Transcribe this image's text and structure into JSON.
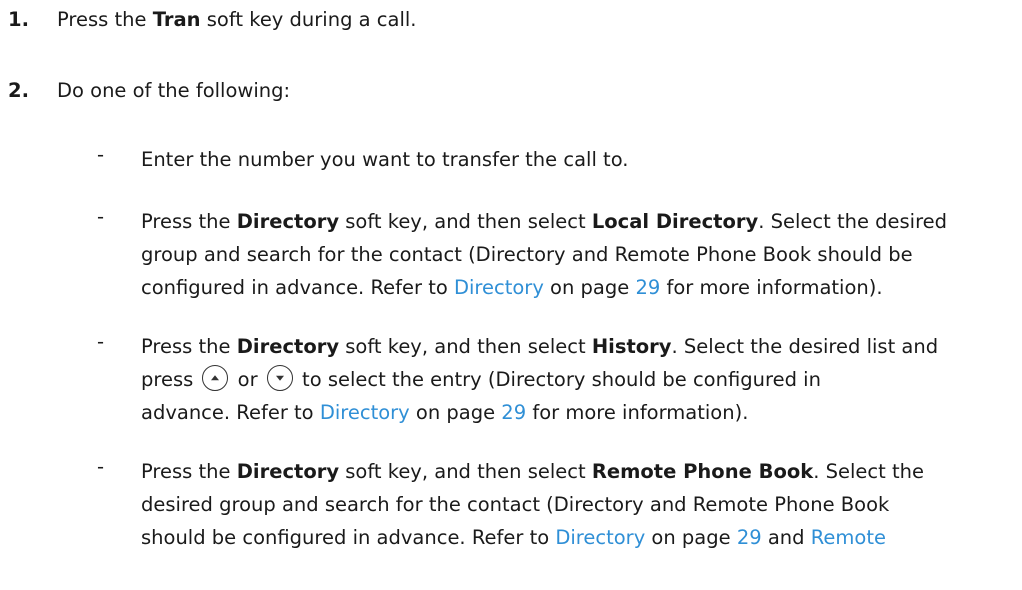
{
  "step1": {
    "number": "1.",
    "pre": "Press the ",
    "key": "Tran",
    "post": " soft key during a call."
  },
  "step2": {
    "number": "2.",
    "text": "Do one of the following:"
  },
  "options": [
    {
      "dash": "-",
      "text": "Enter the number you want to transfer the call to."
    },
    {
      "dash": "-",
      "l1_pre": "Press the ",
      "l1_b1": "Directory",
      "l1_mid": " soft key, and then select ",
      "l1_b2": "Local Directory",
      "l1_post": ". Select the desired",
      "l2": "group and search for the contact (Directory and Remote Phone Book should be",
      "l3_pre": "configured in advance. Refer to ",
      "l3_link": "Directory",
      "l3_mid": " on page ",
      "l3_page": "29",
      "l3_post": " for more information)."
    },
    {
      "dash": "-",
      "l1_pre": "Press the ",
      "l1_b1": "Directory",
      "l1_mid": " soft key, and then select ",
      "l1_b2": "History",
      "l1_post": ". Select the desired list and",
      "l2_pre": "press ",
      "l2_up_icon": "up-arrow-key-icon",
      "l2_or": " or ",
      "l2_down_icon": "down-arrow-key-icon",
      "l2_post": " to select the entry (Directory should be configured in",
      "l3_pre": "advance. Refer to ",
      "l3_link": "Directory",
      "l3_mid": " on page ",
      "l3_page": "29",
      "l3_post": " for more information)."
    },
    {
      "dash": "-",
      "l1_pre": "Press the ",
      "l1_b1": "Directory",
      "l1_mid": " soft key, and then select ",
      "l1_b2": "Remote Phone Book",
      "l1_post": ". Select the",
      "l2": "desired group and search for the contact (Directory and Remote Phone Book",
      "l3_pre": "should be configured in advance. Refer to ",
      "l3_link": "Directory",
      "l3_mid": " on page ",
      "l3_page": "29",
      "l3_and": " and ",
      "l3_link2": "Remote"
    }
  ],
  "colors": {
    "text": "#1a1a1a",
    "link": "#2f8fd6"
  }
}
